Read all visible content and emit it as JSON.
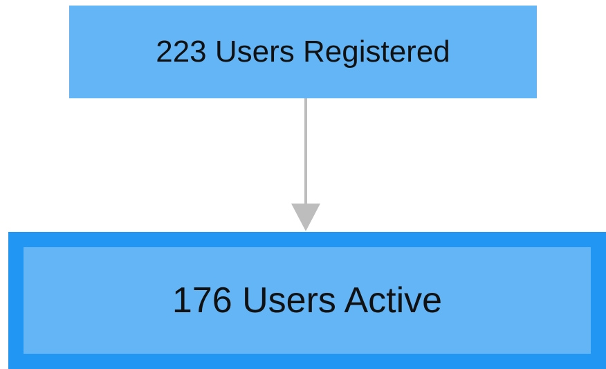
{
  "nodes": {
    "top": {
      "label": "223 Users Registered"
    },
    "bottom": {
      "label": "176 Users Active"
    }
  },
  "colors": {
    "node_fill": "#64b5f6",
    "highlight_border": "#2196f3",
    "connector": "#bdbdbd",
    "text": "#111111",
    "background": "#ffffff"
  }
}
